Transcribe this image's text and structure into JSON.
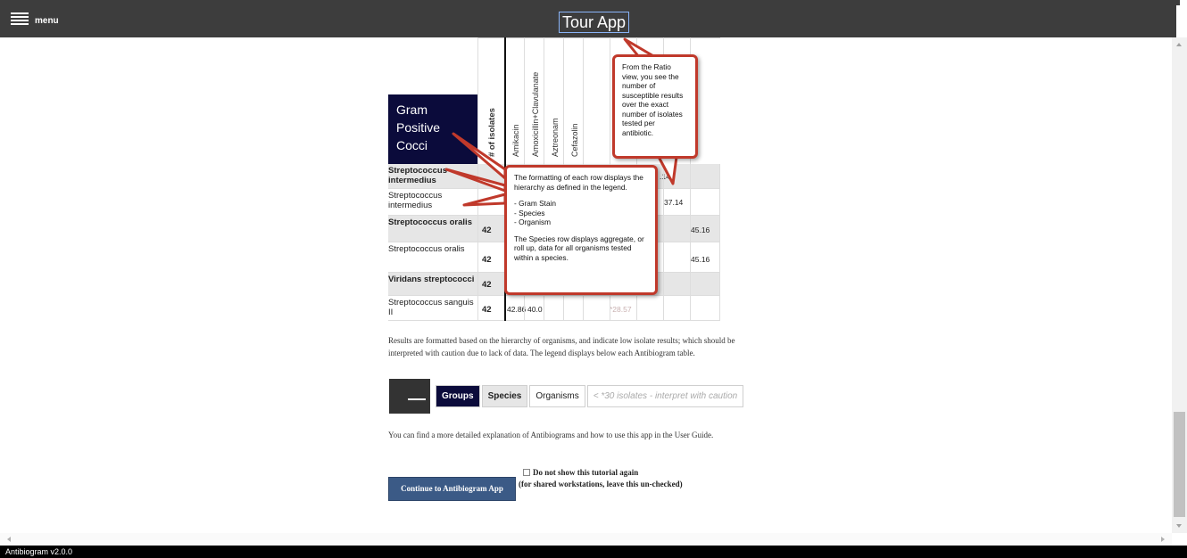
{
  "topbar": {
    "menu_label": "menu",
    "title": "Tour App"
  },
  "table": {
    "group_header": [
      "Gram",
      "Positive",
      "Cocci"
    ],
    "columns": [
      "# of isolates",
      "Amikacin",
      "Amoxicillin+Clavulanate",
      "Aztreonam",
      "Cefazolin"
    ],
    "rows": [
      {
        "name": "Streptococcus intermedius",
        "type": "species",
        "isolates": "",
        "values": [
          "",
          "",
          "",
          "",
          "",
          "",
          "",
          ".14",
          ""
        ]
      },
      {
        "name": "Streptococcus intermedius",
        "type": "organism",
        "isolates": "",
        "values": [
          "",
          "",
          "",
          "",
          "",
          "",
          "",
          "37.14",
          ""
        ]
      },
      {
        "name": "Streptococcus oralis",
        "type": "species",
        "isolates": "42",
        "values": [
          "",
          "",
          "",
          "",
          "",
          "",
          "",
          "",
          "45.16"
        ]
      },
      {
        "name": "Streptococcus oralis",
        "type": "organism",
        "isolates": "42",
        "values": [
          "",
          "",
          "",
          "",
          "",
          "",
          "",
          "",
          "45.16"
        ]
      },
      {
        "name": "Viridans streptococci",
        "type": "species",
        "isolates": "42",
        "values": []
      },
      {
        "name": "Streptococcus sanguis II",
        "type": "organism",
        "isolates": "42",
        "values": [
          "42.86",
          "40.0",
          "",
          "",
          "*28.57",
          "",
          "",
          "",
          ""
        ]
      }
    ]
  },
  "callouts": {
    "ratio": "From the Ratio view, you see the number of susceptible results over the exact number of isolates tested per antibiotic.",
    "formatting": [
      "The formatting of each row displays the hierarchy as defined in the legend.",
      "- Gram Stain",
      "- Species",
      "- Organism",
      "The Species row displays aggregate, or roll up, data for all organisms tested within a species."
    ]
  },
  "description": [
    "Results are formatted based on the hierarchy of organisms, and indicate low isolate results; which should be",
    "interpreted with caution due to lack of data. The legend displays below each Antibiogram table."
  ],
  "legend": {
    "groups": "Groups",
    "species": "Species",
    "organisms": "Organisms",
    "caution": "< *30 isolates - interpret with caution"
  },
  "guide_text": "You can find a more detailed explanation of Antibiograms and how to use this app in the User Guide.",
  "continue_button": "Continue to Antibiogram App",
  "checkbox": {
    "label": "Do not show this tutorial again",
    "note": "(for shared workstations, leave this un-checked)"
  },
  "status_bar": "Antibiogram v2.0.0",
  "colors": {
    "topbar": "#3d3d3d",
    "group_header": "#0b0b3b",
    "callout_border": "#c0392b",
    "button": "#3b5a86"
  }
}
